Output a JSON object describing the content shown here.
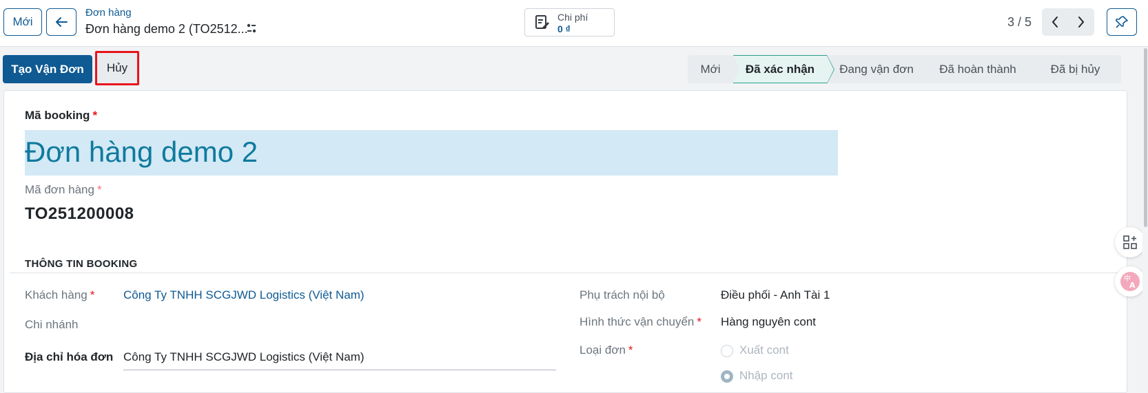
{
  "header": {
    "new_button": "Mới",
    "breadcrumb_parent": "Đơn hàng",
    "breadcrumb_current": "Đơn hàng demo 2 (TO2512...",
    "cost_label": "Chi phí",
    "cost_value": "0 ₫",
    "pager": "3 / 5"
  },
  "actions": {
    "primary": "Tạo Vận Đơn",
    "cancel": "Hủy"
  },
  "statusbar": {
    "stages": [
      "Mới",
      "Đã xác nhận",
      "Đang vận đơn",
      "Đã hoàn thành",
      "Đã bị hủy"
    ],
    "active": "Đã xác nhận"
  },
  "form": {
    "booking_label": "Mã booking",
    "booking_value": "Đơn hàng demo 2",
    "order_label": "Mã đơn hàng",
    "order_value": "TO251200008",
    "section_title": "THÔNG TIN BOOKING",
    "customer_label": "Khách hàng",
    "customer_value": "Công Ty TNHH SCGJWD Logistics (Việt Nam)",
    "branch_label": "Chi nhánh",
    "invoice_address_label": "Địa chỉ hóa đơn",
    "invoice_address_value": "Công Ty TNHH SCGJWD Logistics (Việt Nam)",
    "internal_owner_label": "Phụ trách nội bộ",
    "internal_owner_value": "Điều phối - Anh Tài 1",
    "transport_mode_label": "Hình thức vận chuyển",
    "transport_mode_value": "Hàng nguyên cont",
    "order_type_label": "Loại đơn",
    "order_type_options": [
      "Xuất cont",
      "Nhập cont"
    ],
    "order_type_selected": "Nhập cont",
    "required_mark": "*"
  },
  "colors": {
    "brand": "#0f5a93",
    "highlight": "#e8141b",
    "active_stage_border": "#2d9c8a"
  }
}
